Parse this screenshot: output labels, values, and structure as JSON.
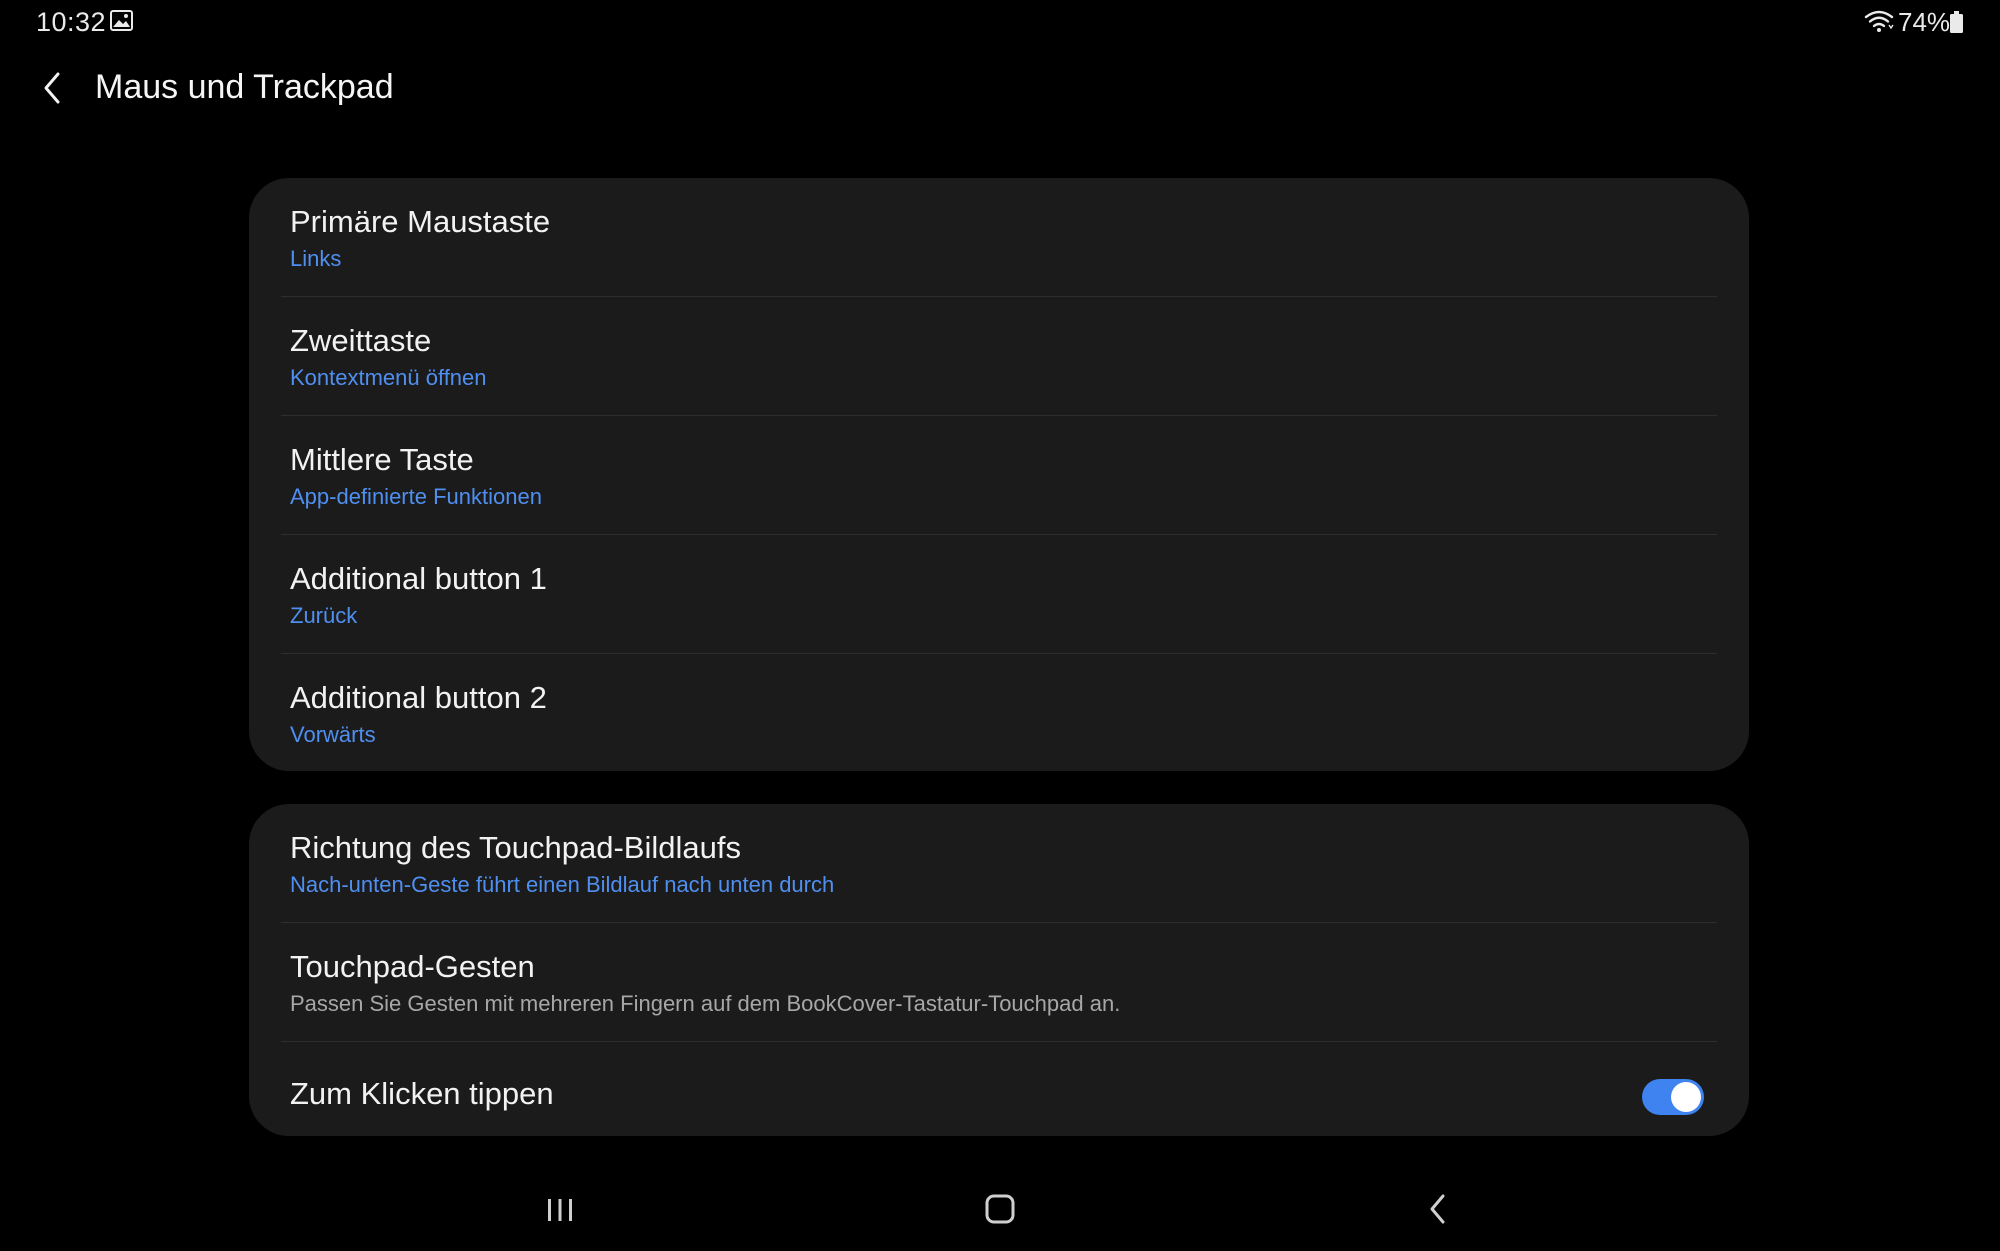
{
  "status_bar": {
    "time": "10:32",
    "notification_icon": "gallery-icon",
    "wifi_icon": "wifi-icon",
    "battery_percent": "74%",
    "battery_icon": "battery-icon"
  },
  "header": {
    "back_icon": "chevron-left-icon",
    "title": "Maus und Trackpad"
  },
  "colors": {
    "background": "#000000",
    "card": "#1b1b1b",
    "accent": "#4f8ff0",
    "toggle_on": "#3e83f0"
  },
  "mouse_buttons": [
    {
      "title": "Primäre Maustaste",
      "value": "Links"
    },
    {
      "title": "Zweittaste",
      "value": "Kontextmenü öffnen"
    },
    {
      "title": "Mittlere Taste",
      "value": "App-definierte Funktionen"
    },
    {
      "title": "Additional button 1",
      "value": "Zurück"
    },
    {
      "title": "Additional button 2",
      "value": "Vorwärts"
    }
  ],
  "touchpad": {
    "scroll_direction": {
      "title": "Richtung des Touchpad-Bildlaufs",
      "value": "Nach-unten-Geste führt einen Bildlauf nach unten durch"
    },
    "gestures": {
      "title": "Touchpad-Gesten",
      "description": "Passen Sie Gesten mit mehreren Fingern auf dem BookCover-Tastatur-Touchpad an."
    },
    "tap_to_click": {
      "title": "Zum Klicken tippen",
      "enabled": true
    }
  },
  "nav_bar": {
    "recents_icon": "recents-icon",
    "home_icon": "home-icon",
    "back_icon": "back-icon"
  }
}
